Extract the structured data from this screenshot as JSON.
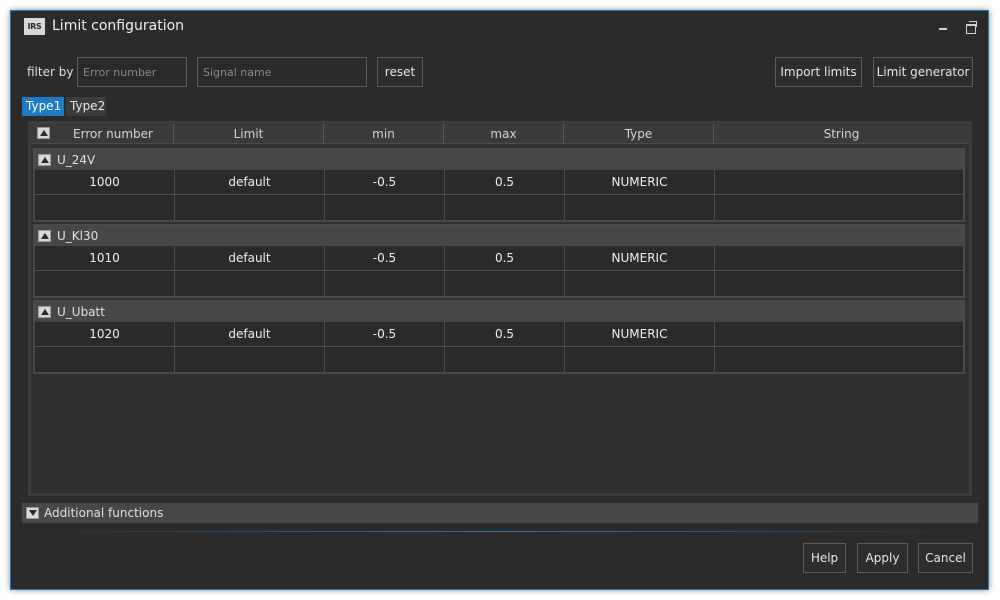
{
  "window": {
    "logo_text": "IRS",
    "title": "Limit configuration",
    "accent_color": "#1c7bc4"
  },
  "filter": {
    "label": "filter by",
    "error_placeholder": "Error number",
    "signal_placeholder": "Signal name",
    "reset_label": "reset"
  },
  "toolbar": {
    "import_label": "Import limits",
    "generator_label": "Limit generator"
  },
  "tabs": [
    {
      "label": "Type1",
      "active": true
    },
    {
      "label": "Type2",
      "active": false
    }
  ],
  "columns": [
    "Error number",
    "Limit",
    "min",
    "max",
    "Type",
    "String"
  ],
  "groups": [
    {
      "name": "U_24V",
      "rows": [
        [
          "1000",
          "default",
          "-0.5",
          "0.5",
          "NUMERIC",
          ""
        ],
        [
          "",
          "",
          "",
          "",
          "",
          ""
        ]
      ]
    },
    {
      "name": "U_Kl30",
      "rows": [
        [
          "1010",
          "default",
          "-0.5",
          "0.5",
          "NUMERIC",
          ""
        ],
        [
          "",
          "",
          "",
          "",
          "",
          ""
        ]
      ]
    },
    {
      "name": "U_Ubatt",
      "rows": [
        [
          "1020",
          "default",
          "-0.5",
          "0.5",
          "NUMERIC",
          ""
        ],
        [
          "",
          "",
          "",
          "",
          "",
          ""
        ]
      ]
    }
  ],
  "additional": {
    "label": "Additional functions"
  },
  "footer": {
    "help_label": "Help",
    "apply_label": "Apply",
    "cancel_label": "Cancel"
  },
  "icons": {
    "logo": "irs-logo-icon",
    "minimize": "minimize-icon",
    "maximize": "restore-icon",
    "collapse": "collapse-arrow-icon",
    "expand": "expand-arrow-icon"
  }
}
